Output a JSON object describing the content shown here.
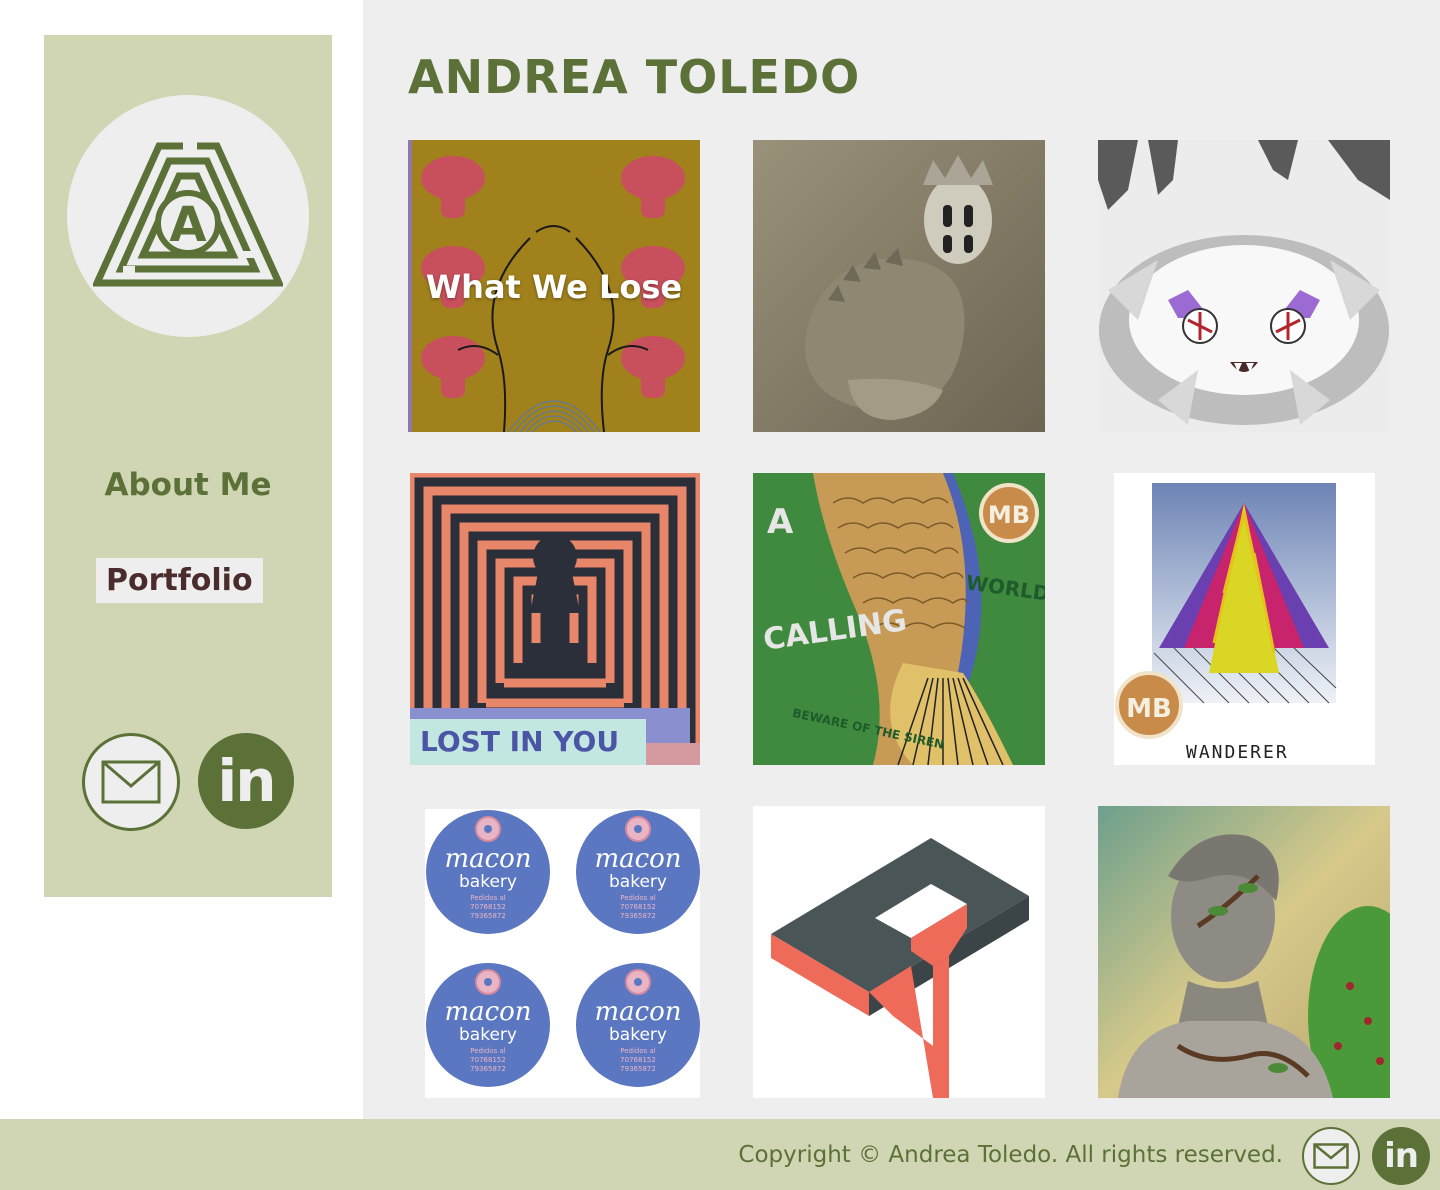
{
  "site": {
    "title": "ANDREA TOLEDO"
  },
  "sidebar": {
    "logo": "maze-a-logo-icon",
    "nav": [
      {
        "label": "About Me"
      },
      {
        "label": "Portfolio",
        "active": true
      }
    ],
    "social": [
      "mail-icon",
      "linkedin-icon"
    ],
    "linkedin_glyph": "in"
  },
  "gallery": {
    "items": [
      {
        "name": "what-we-lose",
        "overlay": "What We Lose"
      },
      {
        "name": "crowned-figure"
      },
      {
        "name": "furry-creature"
      },
      {
        "name": "lost-in-you",
        "caption": "LOST IN YOU"
      },
      {
        "name": "a-calling",
        "caption_left": "A",
        "caption_main": "CALLING",
        "caption_right": "WORLD TOUR",
        "caption_sign": "BEWARE OF THE SIREN"
      },
      {
        "name": "wanderer",
        "caption": "WANDERER"
      },
      {
        "name": "macon-bakery",
        "label_1": "macon",
        "label_2": "bakery",
        "label_3": "Pedidos al",
        "label_4": "70768152",
        "label_5": "79365872"
      },
      {
        "name": "isometric-at-logo"
      },
      {
        "name": "grey-figure-painting"
      }
    ]
  },
  "footer": {
    "copyright": "Copyright © Andrea Toledo. All rights reserved.",
    "linkedin_glyph": "in"
  },
  "colors": {
    "accent": "#5b7137",
    "sidebar_bg": "#d0d6b3",
    "main_bg": "#eeeeee",
    "portfolio_text": "#4b2c2c"
  }
}
